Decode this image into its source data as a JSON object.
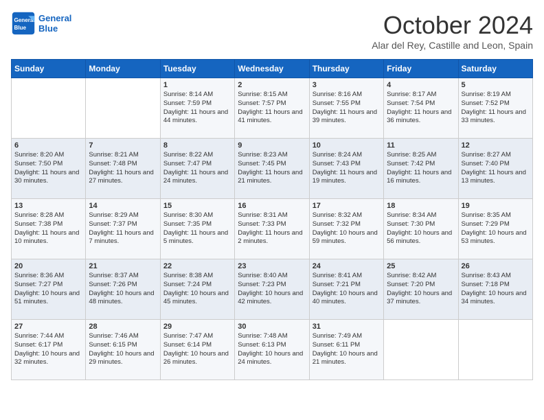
{
  "header": {
    "logo_line1": "General",
    "logo_line2": "Blue",
    "month_title": "October 2024",
    "subtitle": "Alar del Rey, Castille and Leon, Spain"
  },
  "days_of_week": [
    "Sunday",
    "Monday",
    "Tuesday",
    "Wednesday",
    "Thursday",
    "Friday",
    "Saturday"
  ],
  "weeks": [
    [
      {
        "day": "",
        "info": ""
      },
      {
        "day": "",
        "info": ""
      },
      {
        "day": "1",
        "info": "Sunrise: 8:14 AM\nSunset: 7:59 PM\nDaylight: 11 hours and 44 minutes."
      },
      {
        "day": "2",
        "info": "Sunrise: 8:15 AM\nSunset: 7:57 PM\nDaylight: 11 hours and 41 minutes."
      },
      {
        "day": "3",
        "info": "Sunrise: 8:16 AM\nSunset: 7:55 PM\nDaylight: 11 hours and 39 minutes."
      },
      {
        "day": "4",
        "info": "Sunrise: 8:17 AM\nSunset: 7:54 PM\nDaylight: 11 hours and 36 minutes."
      },
      {
        "day": "5",
        "info": "Sunrise: 8:19 AM\nSunset: 7:52 PM\nDaylight: 11 hours and 33 minutes."
      }
    ],
    [
      {
        "day": "6",
        "info": "Sunrise: 8:20 AM\nSunset: 7:50 PM\nDaylight: 11 hours and 30 minutes."
      },
      {
        "day": "7",
        "info": "Sunrise: 8:21 AM\nSunset: 7:48 PM\nDaylight: 11 hours and 27 minutes."
      },
      {
        "day": "8",
        "info": "Sunrise: 8:22 AM\nSunset: 7:47 PM\nDaylight: 11 hours and 24 minutes."
      },
      {
        "day": "9",
        "info": "Sunrise: 8:23 AM\nSunset: 7:45 PM\nDaylight: 11 hours and 21 minutes."
      },
      {
        "day": "10",
        "info": "Sunrise: 8:24 AM\nSunset: 7:43 PM\nDaylight: 11 hours and 19 minutes."
      },
      {
        "day": "11",
        "info": "Sunrise: 8:25 AM\nSunset: 7:42 PM\nDaylight: 11 hours and 16 minutes."
      },
      {
        "day": "12",
        "info": "Sunrise: 8:27 AM\nSunset: 7:40 PM\nDaylight: 11 hours and 13 minutes."
      }
    ],
    [
      {
        "day": "13",
        "info": "Sunrise: 8:28 AM\nSunset: 7:38 PM\nDaylight: 11 hours and 10 minutes."
      },
      {
        "day": "14",
        "info": "Sunrise: 8:29 AM\nSunset: 7:37 PM\nDaylight: 11 hours and 7 minutes."
      },
      {
        "day": "15",
        "info": "Sunrise: 8:30 AM\nSunset: 7:35 PM\nDaylight: 11 hours and 5 minutes."
      },
      {
        "day": "16",
        "info": "Sunrise: 8:31 AM\nSunset: 7:33 PM\nDaylight: 11 hours and 2 minutes."
      },
      {
        "day": "17",
        "info": "Sunrise: 8:32 AM\nSunset: 7:32 PM\nDaylight: 10 hours and 59 minutes."
      },
      {
        "day": "18",
        "info": "Sunrise: 8:34 AM\nSunset: 7:30 PM\nDaylight: 10 hours and 56 minutes."
      },
      {
        "day": "19",
        "info": "Sunrise: 8:35 AM\nSunset: 7:29 PM\nDaylight: 10 hours and 53 minutes."
      }
    ],
    [
      {
        "day": "20",
        "info": "Sunrise: 8:36 AM\nSunset: 7:27 PM\nDaylight: 10 hours and 51 minutes."
      },
      {
        "day": "21",
        "info": "Sunrise: 8:37 AM\nSunset: 7:26 PM\nDaylight: 10 hours and 48 minutes."
      },
      {
        "day": "22",
        "info": "Sunrise: 8:38 AM\nSunset: 7:24 PM\nDaylight: 10 hours and 45 minutes."
      },
      {
        "day": "23",
        "info": "Sunrise: 8:40 AM\nSunset: 7:23 PM\nDaylight: 10 hours and 42 minutes."
      },
      {
        "day": "24",
        "info": "Sunrise: 8:41 AM\nSunset: 7:21 PM\nDaylight: 10 hours and 40 minutes."
      },
      {
        "day": "25",
        "info": "Sunrise: 8:42 AM\nSunset: 7:20 PM\nDaylight: 10 hours and 37 minutes."
      },
      {
        "day": "26",
        "info": "Sunrise: 8:43 AM\nSunset: 7:18 PM\nDaylight: 10 hours and 34 minutes."
      }
    ],
    [
      {
        "day": "27",
        "info": "Sunrise: 7:44 AM\nSunset: 6:17 PM\nDaylight: 10 hours and 32 minutes."
      },
      {
        "day": "28",
        "info": "Sunrise: 7:46 AM\nSunset: 6:15 PM\nDaylight: 10 hours and 29 minutes."
      },
      {
        "day": "29",
        "info": "Sunrise: 7:47 AM\nSunset: 6:14 PM\nDaylight: 10 hours and 26 minutes."
      },
      {
        "day": "30",
        "info": "Sunrise: 7:48 AM\nSunset: 6:13 PM\nDaylight: 10 hours and 24 minutes."
      },
      {
        "day": "31",
        "info": "Sunrise: 7:49 AM\nSunset: 6:11 PM\nDaylight: 10 hours and 21 minutes."
      },
      {
        "day": "",
        "info": ""
      },
      {
        "day": "",
        "info": ""
      }
    ]
  ]
}
